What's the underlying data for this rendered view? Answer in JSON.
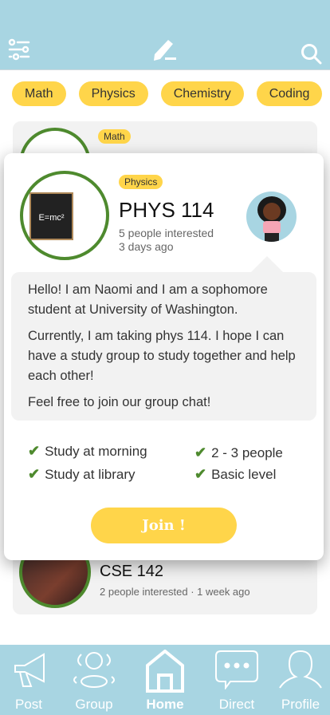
{
  "header": {
    "filter_icon": "sliders-icon",
    "compose_icon": "pencil-icon",
    "search_icon": "search-icon"
  },
  "chips": [
    "Math",
    "Physics",
    "Chemistry",
    "Coding"
  ],
  "background_cards": [
    {
      "tag": "Math"
    },
    {
      "title": "CSE 142",
      "meta": "2 people interested · 1 week ago"
    }
  ],
  "modal": {
    "tag": "Physics",
    "title": "PHYS 114",
    "interested": "5 people interested",
    "posted": "3 days ago",
    "image_text": "E=mc²",
    "message": [
      "Hello! I am Naomi and I am a sophomore student at University of Washington.",
      "Currently, I am taking phys 114. I hope I can have a study group to study together and help each other!",
      "Feel free to join our group chat!"
    ],
    "features": [
      "Study at morning",
      "2 - 3 people",
      "Study at library",
      "Basic level"
    ],
    "join_label": "Join !"
  },
  "nav": [
    {
      "label": "Post",
      "icon": "megaphone-icon"
    },
    {
      "label": "Group",
      "icon": "group-icon"
    },
    {
      "label": "Home",
      "icon": "home-icon",
      "active": true
    },
    {
      "label": "Direct",
      "icon": "chat-icon"
    },
    {
      "label": "Profile",
      "icon": "profile-icon"
    }
  ],
  "colors": {
    "header": "#a8d5e2",
    "accent": "#ffd54a",
    "ring": "#4e8a2e"
  }
}
